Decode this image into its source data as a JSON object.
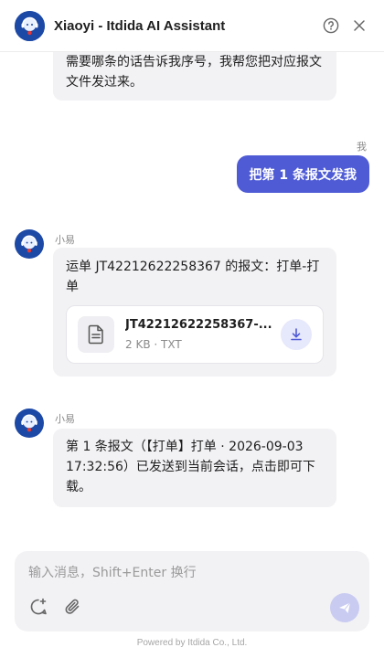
{
  "header": {
    "title": "Xiaoyi - Itdida AI Assistant",
    "help_icon": "question-circle-icon",
    "close_icon": "close-icon",
    "avatar_icon": "assistant-avatar-icon"
  },
  "messages": {
    "prev_bot_text": "需要哪条的话告诉我序号，我帮您把对应报文文件发过来。",
    "user": {
      "name": "我",
      "text": "把第 1 条报文发我"
    },
    "bot_file": {
      "name": "小易",
      "text": "运单 JT42212622258367 的报文：打单-打单",
      "file": {
        "name": "JT42212622258367-...",
        "meta": "2 KB · TXT",
        "icon": "document-icon",
        "action_icon": "download-icon"
      }
    },
    "bot_confirm": {
      "name": "小易",
      "text": "第 1 条报文（【打单】打单 · 2026-09-03 17:32:56）已发送到当前会话，点击即可下载。"
    }
  },
  "composer": {
    "placeholder": "输入消息，Shift+Enter 换行",
    "value": "",
    "new_chat_icon": "new-chat-icon",
    "attach_icon": "paperclip-icon",
    "send_icon": "send-icon"
  },
  "footer": {
    "text": "Powered by Itdida Co., Ltd."
  },
  "colors": {
    "accent": "#4f5bd5",
    "avatar_bg": "#1d49a6",
    "bubble_bg": "#f2f2f5",
    "send_disabled": "#c9cbf1"
  }
}
